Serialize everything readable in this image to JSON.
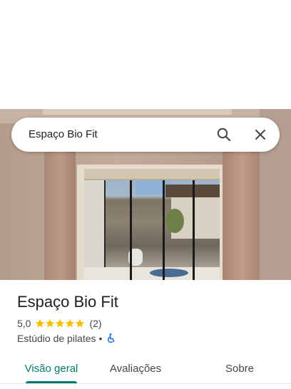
{
  "search": {
    "query": "Espaço Bio Fit",
    "search_icon": "search-icon",
    "close_icon": "close-icon"
  },
  "place": {
    "name": "Espaço Bio Fit",
    "rating": "5,0",
    "stars_filled": 5,
    "stars_total": 5,
    "review_count": "(2)",
    "category": "Estúdio de pilates",
    "separator": "•",
    "accessibility_icon": "wheelchair-icon"
  },
  "tabs": [
    {
      "label": "Visão geral",
      "selected": true
    },
    {
      "label": "Avaliações",
      "selected": false
    },
    {
      "label": "Sobre",
      "selected": false
    }
  ],
  "colors": {
    "accent": "#00796b",
    "star": "#fbbc04",
    "accessibility": "#1a73e8"
  }
}
